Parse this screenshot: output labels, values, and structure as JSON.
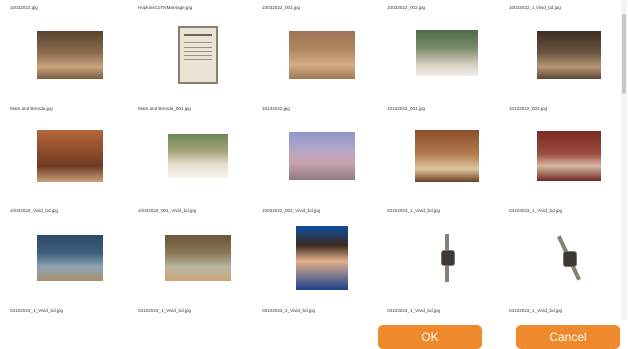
{
  "files": [
    "10032022.jpg",
    "HopkinsCoTNMarriage.jpg",
    "10032022_001.jpg",
    "10032022_002.jpg",
    "10032022_1.Vivid_bd.jpg",
    "Mark and Brenda.jpg",
    "Mark and Brenda_001.jpg",
    "10132022.jpg",
    "10132022_001.jpg",
    "10132022_002.jpg",
    "10032022_Vivid_bd.jpg",
    "10032022_001_Vivid_bd.jpg",
    "10032022_002_Vivid_bd.jpg",
    "03102023_1_Vivid_bd.jpg",
    "03102023_1_Vivid_bd.jpg",
    "03102023_1_Vivid_bd.jpg",
    "03102023_1_Vivid_bd.jpg",
    "03102023_2_Vivid_bd.jpg",
    "03102023_1_Vivid_bd.jpg",
    "03102023_1_Vivid_bd.jpg"
  ],
  "buttons": {
    "ok_label": "OK",
    "cancel_label": "Cancel"
  },
  "colors": {
    "accent": "#ef8a2c",
    "button_text": "#ffffff"
  }
}
